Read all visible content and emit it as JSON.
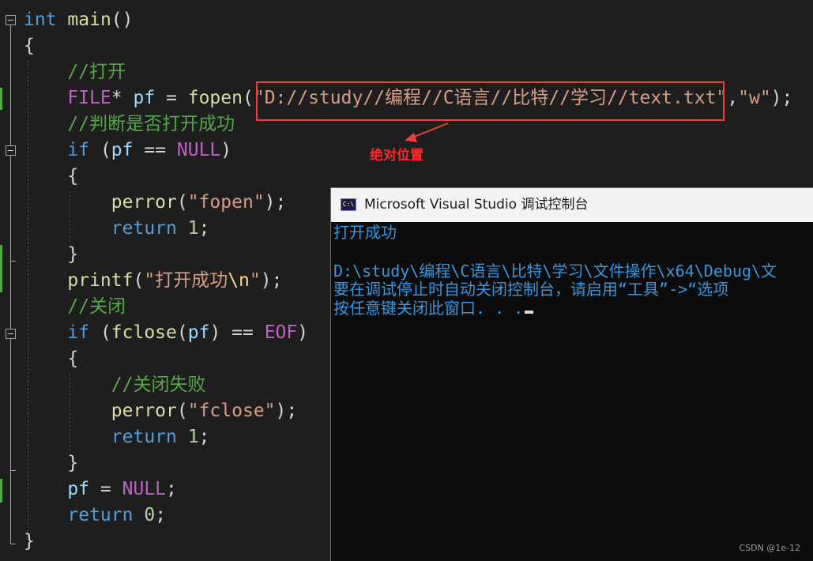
{
  "editor": {
    "lines": [
      [
        {
          "t": "int",
          "c": "kw"
        },
        {
          "t": " ",
          "c": "pl"
        },
        {
          "t": "main",
          "c": "fn"
        },
        {
          "t": "()",
          "c": "pl"
        }
      ],
      [
        {
          "t": "{",
          "c": "pl"
        }
      ],
      [
        {
          "t": "    //打开",
          "c": "cm"
        }
      ],
      [
        {
          "t": "    ",
          "c": "pl"
        },
        {
          "t": "FILE",
          "c": "mac"
        },
        {
          "t": "* ",
          "c": "pl"
        },
        {
          "t": "pf",
          "c": "var"
        },
        {
          "t": " = ",
          "c": "pl"
        },
        {
          "t": "fopen",
          "c": "fn"
        },
        {
          "t": "(",
          "c": "pl"
        },
        {
          "t": "\"D://study//编程//C语言//比特//学习//text.txt\"",
          "c": "st"
        },
        {
          "t": ",",
          "c": "pl"
        },
        {
          "t": "\"w\"",
          "c": "st"
        },
        {
          "t": ");",
          "c": "pl"
        }
      ],
      [
        {
          "t": "    //判断是否打开成功",
          "c": "cm"
        }
      ],
      [
        {
          "t": "    ",
          "c": "pl"
        },
        {
          "t": "if",
          "c": "kw"
        },
        {
          "t": " (",
          "c": "pl"
        },
        {
          "t": "pf",
          "c": "var"
        },
        {
          "t": " == ",
          "c": "pl"
        },
        {
          "t": "NULL",
          "c": "mac"
        },
        {
          "t": ")",
          "c": "pl"
        }
      ],
      [
        {
          "t": "    {",
          "c": "pl"
        }
      ],
      [
        {
          "t": "        ",
          "c": "pl"
        },
        {
          "t": "perror",
          "c": "fn"
        },
        {
          "t": "(",
          "c": "pl"
        },
        {
          "t": "\"fopen\"",
          "c": "st"
        },
        {
          "t": ");",
          "c": "pl"
        }
      ],
      [
        {
          "t": "        ",
          "c": "pl"
        },
        {
          "t": "return",
          "c": "kw"
        },
        {
          "t": " ",
          "c": "pl"
        },
        {
          "t": "1",
          "c": "num"
        },
        {
          "t": ";",
          "c": "pl"
        }
      ],
      [
        {
          "t": "    }",
          "c": "pl"
        }
      ],
      [
        {
          "t": "    ",
          "c": "pl"
        },
        {
          "t": "printf",
          "c": "fn"
        },
        {
          "t": "(",
          "c": "pl"
        },
        {
          "t": "\"打开成功",
          "c": "st"
        },
        {
          "t": "\\n",
          "c": "esc"
        },
        {
          "t": "\"",
          "c": "st"
        },
        {
          "t": ");",
          "c": "pl"
        }
      ],
      [
        {
          "t": "    //关闭",
          "c": "cm"
        }
      ],
      [
        {
          "t": "    ",
          "c": "pl"
        },
        {
          "t": "if",
          "c": "kw"
        },
        {
          "t": " (",
          "c": "pl"
        },
        {
          "t": "fclose",
          "c": "fn"
        },
        {
          "t": "(",
          "c": "pl"
        },
        {
          "t": "pf",
          "c": "var"
        },
        {
          "t": ") == ",
          "c": "pl"
        },
        {
          "t": "EOF",
          "c": "mac"
        },
        {
          "t": ")",
          "c": "pl"
        }
      ],
      [
        {
          "t": "    {",
          "c": "pl"
        }
      ],
      [
        {
          "t": "        //关闭失败",
          "c": "cm"
        }
      ],
      [
        {
          "t": "        ",
          "c": "pl"
        },
        {
          "t": "perror",
          "c": "fn"
        },
        {
          "t": "(",
          "c": "pl"
        },
        {
          "t": "\"fclose\"",
          "c": "st"
        },
        {
          "t": ");",
          "c": "pl"
        }
      ],
      [
        {
          "t": "        ",
          "c": "pl"
        },
        {
          "t": "return",
          "c": "kw"
        },
        {
          "t": " ",
          "c": "pl"
        },
        {
          "t": "1",
          "c": "num"
        },
        {
          "t": ";",
          "c": "pl"
        }
      ],
      [
        {
          "t": "    }",
          "c": "pl"
        }
      ],
      [
        {
          "t": "    ",
          "c": "pl"
        },
        {
          "t": "pf",
          "c": "var"
        },
        {
          "t": " = ",
          "c": "pl"
        },
        {
          "t": "NULL",
          "c": "mac"
        },
        {
          "t": ";",
          "c": "pl"
        }
      ],
      [
        {
          "t": "    ",
          "c": "pl"
        },
        {
          "t": "return",
          "c": "kw"
        },
        {
          "t": " ",
          "c": "pl"
        },
        {
          "t": "0",
          "c": "num"
        },
        {
          "t": ";",
          "c": "pl"
        }
      ],
      [
        {
          "t": "}",
          "c": "pl"
        }
      ]
    ]
  },
  "annotation": {
    "label": "绝对位置",
    "color": "#ff2a2a"
  },
  "console": {
    "icon_text": "C:\\",
    "title": "Microsoft Visual Studio 调试控制台",
    "output_lines": [
      "打开成功",
      "",
      "D:\\study\\编程\\C语言\\比特\\学习\\文件操作\\x64\\Debug\\文",
      "要在调试停止时自动关闭控制台，请启用“工具”->“选项",
      "按任意键关闭此窗口. . ."
    ]
  },
  "watermark": "CSDN @1e-12",
  "colors": {
    "editor_bg": "#1e1e1e",
    "keyword": "#569cd6",
    "comment": "#57a64a",
    "string": "#d69d85",
    "function": "#dcdcaa",
    "macro": "#bd63c5",
    "console_text": "#3a96dd",
    "highlight_box": "#e8413c"
  }
}
